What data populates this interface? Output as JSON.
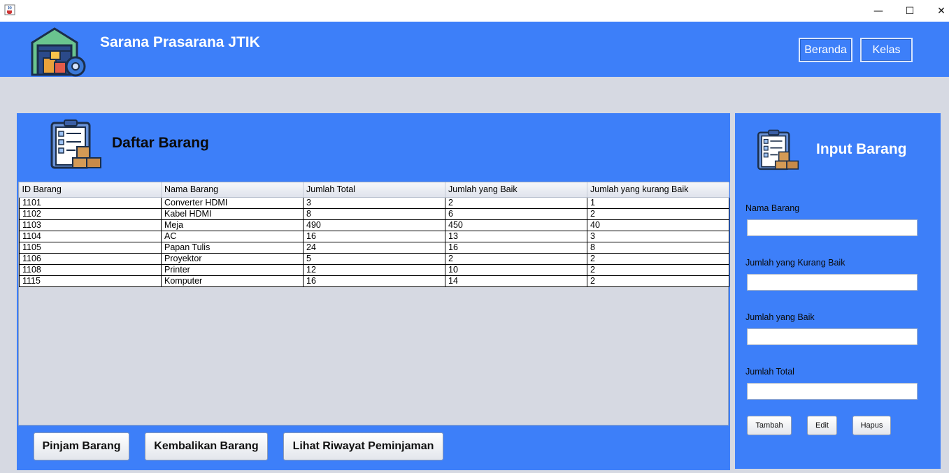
{
  "window": {
    "minimize_glyph": "—",
    "maximize_glyph": "☐",
    "close_glyph": "✕"
  },
  "header": {
    "title": "Sarana Prasarana JTIK",
    "nav": {
      "beranda": "Beranda",
      "kelas": "Kelas"
    }
  },
  "daftar": {
    "title": "Daftar Barang",
    "columns": [
      "ID Barang",
      "Nama Barang",
      "Jumlah Total",
      "Jumlah yang Baik",
      "Jumlah yang kurang Baik"
    ],
    "rows": [
      [
        "1101",
        "Converter HDMI",
        "3",
        "2",
        "1"
      ],
      [
        "1102",
        "Kabel HDMI",
        "8",
        "6",
        "2"
      ],
      [
        "1103",
        "Meja",
        "490",
        "450",
        "40"
      ],
      [
        "1104",
        "AC",
        "16",
        "13",
        "3"
      ],
      [
        "1105",
        "Papan Tulis",
        "24",
        "16",
        "8"
      ],
      [
        "1106",
        "Proyektor",
        "5",
        "2",
        "2"
      ],
      [
        "1108",
        "Printer",
        "12",
        "10",
        "2"
      ],
      [
        "1115",
        "Komputer",
        "16",
        "14",
        "2"
      ]
    ],
    "buttons": {
      "pinjam": "Pinjam Barang",
      "kembali": "Kembalikan Barang",
      "riwayat": "Lihat Riwayat Peminjaman"
    }
  },
  "input": {
    "title": "Input Barang",
    "fields": {
      "nama": {
        "label": "Nama Barang",
        "value": ""
      },
      "kurang_baik": {
        "label": "Jumlah yang Kurang Baik",
        "value": ""
      },
      "baik": {
        "label": "Jumlah yang Baik",
        "value": ""
      },
      "total": {
        "label": "Jumlah Total",
        "value": ""
      }
    },
    "buttons": {
      "tambah": "Tambah",
      "edit": "Edit",
      "hapus": "Hapus"
    }
  },
  "colors": {
    "primary": "#3d7ff9",
    "background": "#d6d9e2"
  },
  "icons": {
    "app": "java-cup-icon",
    "logo": "warehouse-gear-icon",
    "list": "clipboard-boxes-icon"
  }
}
